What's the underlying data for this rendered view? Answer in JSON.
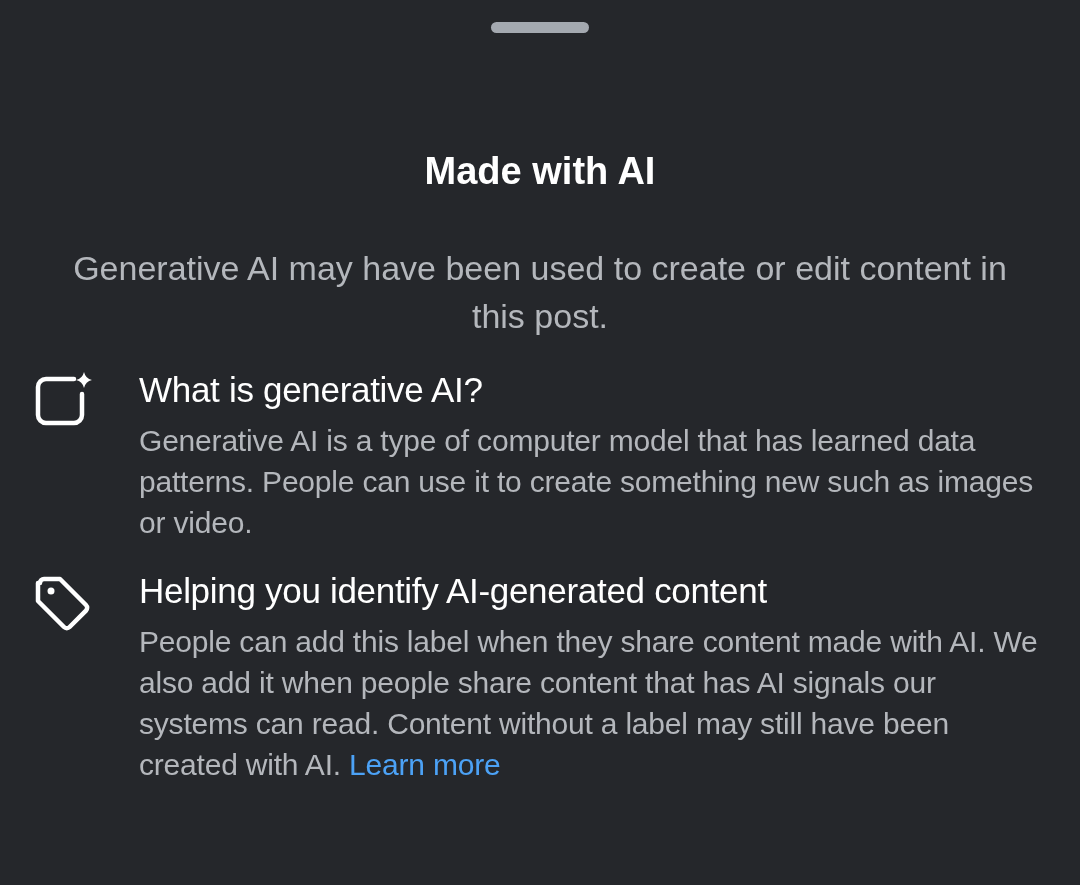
{
  "sheet": {
    "title": "Made with AI",
    "subtitle": "Generative AI may have been used to create or edit content in this post."
  },
  "sections": [
    {
      "kind": "sparkle",
      "heading": "What is generative AI?",
      "body": "Generative AI is a type of computer model that has learned data patterns. People can use it to create something new such as images or video."
    },
    {
      "kind": "tag",
      "heading": "Helping you identify AI-generated content",
      "body": "People can add this label when they share content made with AI. We also add it when people share content that has AI signals our systems can read. Content without a label may still have been created with AI.",
      "link": "Learn more"
    }
  ]
}
